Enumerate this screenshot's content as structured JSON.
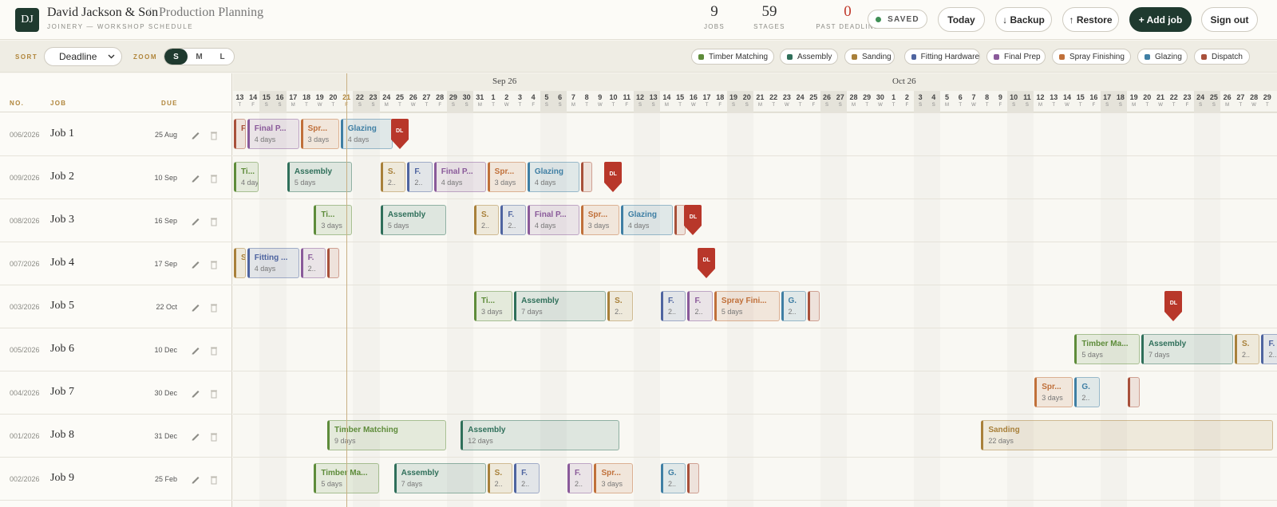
{
  "header": {
    "logo": "DJ",
    "company": "David Jackson & Son",
    "separator": "/",
    "page": "Production Planning",
    "subtitle": "JOINERY — WORKSHOP SCHEDULE",
    "stats": [
      {
        "value": "9",
        "label": "JOBS"
      },
      {
        "value": "59",
        "label": "STAGES"
      },
      {
        "value": "0",
        "label": "PAST DEADLINE"
      }
    ],
    "saved": "SAVED",
    "buttons": {
      "today": "Today",
      "backup": "↓ Backup",
      "restore": "↑ Restore",
      "add_job": "+ Add job",
      "sign_out": "Sign out"
    }
  },
  "toolbar": {
    "sort_label": "SORT",
    "sort_value": "Deadline",
    "zoom_label": "ZOOM",
    "zoom": [
      "S",
      "M",
      "L"
    ],
    "zoom_active": "S"
  },
  "stages": [
    {
      "name": "Timber Matching",
      "color": "#5e8c3a"
    },
    {
      "name": "Assembly",
      "color": "#2f6f5a"
    },
    {
      "name": "Sanding",
      "color": "#a8803a"
    },
    {
      "name": "Fitting Hardware",
      "color": "#4e64a0"
    },
    {
      "name": "Final Prep",
      "color": "#8a5a9a"
    },
    {
      "name": "Spray Finishing",
      "color": "#c0703a"
    },
    {
      "name": "Glazing",
      "color": "#3f7fa4"
    },
    {
      "name": "Dispatch",
      "color": "#a8503a"
    }
  ],
  "columns": {
    "no": "NO.",
    "job": "JOB",
    "due": "DUE"
  },
  "jobs": [
    {
      "no": "006/2026",
      "name": "Job 1",
      "due": "25 Aug"
    },
    {
      "no": "009/2026",
      "name": "Job 2",
      "due": "10 Sep"
    },
    {
      "no": "008/2026",
      "name": "Job 3",
      "due": "16 Sep"
    },
    {
      "no": "007/2026",
      "name": "Job 4",
      "due": "17 Sep"
    },
    {
      "no": "003/2026",
      "name": "Job 5",
      "due": "22 Oct"
    },
    {
      "no": "005/2026",
      "name": "Job 6",
      "due": "10 Dec"
    },
    {
      "no": "004/2026",
      "name": "Job 7",
      "due": "30 Dec"
    },
    {
      "no": "001/2026",
      "name": "Job 8",
      "due": "31 Dec"
    },
    {
      "no": "002/2026",
      "name": "Job 9",
      "due": "25 Feb"
    }
  ],
  "timeline": {
    "months": [
      "Sep 26",
      "Oct 26"
    ],
    "start_date": "2026-08-13",
    "days_visible": 78,
    "today": "2026-08-21",
    "deadline_marker": "DL",
    "bars": [
      {
        "row": 0,
        "stage": 7,
        "start": "2026-08-13",
        "days": 1,
        "title": "F.",
        "sub": ""
      },
      {
        "row": 0,
        "stage": 4,
        "start": "2026-08-14",
        "days": 4,
        "title": "Final P...",
        "sub": "4 days"
      },
      {
        "row": 0,
        "stage": 5,
        "start": "2026-08-18",
        "days": 3,
        "title": "Spr...",
        "sub": "3 days"
      },
      {
        "row": 0,
        "stage": 6,
        "start": "2026-08-21",
        "days": 4,
        "title": "Glazing",
        "sub": "4 days"
      },
      {
        "row": 1,
        "stage": 0,
        "start": "2026-08-13",
        "days": 2,
        "title": "Ti...",
        "sub": "4 days"
      },
      {
        "row": 1,
        "stage": 1,
        "start": "2026-08-17",
        "days": 5,
        "title": "Assembly",
        "sub": "5 days"
      },
      {
        "row": 1,
        "stage": 2,
        "start": "2026-08-24",
        "days": 2,
        "title": "S.",
        "sub": "2.."
      },
      {
        "row": 1,
        "stage": 3,
        "start": "2026-08-26",
        "days": 2,
        "title": "F.",
        "sub": "2.."
      },
      {
        "row": 1,
        "stage": 4,
        "start": "2026-08-28",
        "days": 4,
        "title": "Final P...",
        "sub": "4 days"
      },
      {
        "row": 1,
        "stage": 5,
        "start": "2026-09-01",
        "days": 3,
        "title": "Spr...",
        "sub": "3 days"
      },
      {
        "row": 1,
        "stage": 6,
        "start": "2026-09-04",
        "days": 4,
        "title": "Glazing",
        "sub": "4 days"
      },
      {
        "row": 1,
        "stage": 7,
        "start": "2026-09-08",
        "days": 1,
        "title": "",
        "sub": ""
      },
      {
        "row": 2,
        "stage": 0,
        "start": "2026-08-19",
        "days": 3,
        "title": "Ti...",
        "sub": "3 days"
      },
      {
        "row": 2,
        "stage": 1,
        "start": "2026-08-24",
        "days": 5,
        "title": "Assembly",
        "sub": "5 days"
      },
      {
        "row": 2,
        "stage": 2,
        "start": "2026-08-31",
        "days": 2,
        "title": "S.",
        "sub": "2.."
      },
      {
        "row": 2,
        "stage": 3,
        "start": "2026-09-02",
        "days": 2,
        "title": "F.",
        "sub": "2.."
      },
      {
        "row": 2,
        "stage": 4,
        "start": "2026-09-04",
        "days": 4,
        "title": "Final P...",
        "sub": "4 days"
      },
      {
        "row": 2,
        "stage": 5,
        "start": "2026-09-08",
        "days": 3,
        "title": "Spr...",
        "sub": "3 days"
      },
      {
        "row": 2,
        "stage": 6,
        "start": "2026-09-11",
        "days": 4,
        "title": "Glazing",
        "sub": "4 days"
      },
      {
        "row": 2,
        "stage": 7,
        "start": "2026-09-15",
        "days": 1,
        "title": "",
        "sub": ""
      },
      {
        "row": 3,
        "stage": 2,
        "start": "2026-08-13",
        "days": 1,
        "title": "S.",
        "sub": ""
      },
      {
        "row": 3,
        "stage": 3,
        "start": "2026-08-14",
        "days": 4,
        "title": "Fitting ...",
        "sub": "4 days"
      },
      {
        "row": 3,
        "stage": 4,
        "start": "2026-08-18",
        "days": 2,
        "title": "F.",
        "sub": "2.."
      },
      {
        "row": 3,
        "stage": 7,
        "start": "2026-08-20",
        "days": 1,
        "title": "",
        "sub": ""
      },
      {
        "row": 4,
        "stage": 0,
        "start": "2026-08-31",
        "days": 3,
        "title": "Ti...",
        "sub": "3 days"
      },
      {
        "row": 4,
        "stage": 1,
        "start": "2026-09-03",
        "days": 7,
        "title": "Assembly",
        "sub": "7 days"
      },
      {
        "row": 4,
        "stage": 2,
        "start": "2026-09-10",
        "days": 2,
        "title": "S.",
        "sub": "2.."
      },
      {
        "row": 4,
        "stage": 3,
        "start": "2026-09-14",
        "days": 2,
        "title": "F.",
        "sub": "2.."
      },
      {
        "row": 4,
        "stage": 4,
        "start": "2026-09-16",
        "days": 2,
        "title": "F.",
        "sub": "2.."
      },
      {
        "row": 4,
        "stage": 5,
        "start": "2026-09-18",
        "days": 5,
        "title": "Spray Fini...",
        "sub": "5 days"
      },
      {
        "row": 4,
        "stage": 6,
        "start": "2026-09-23",
        "days": 2,
        "title": "G.",
        "sub": "2.."
      },
      {
        "row": 4,
        "stage": 7,
        "start": "2026-09-25",
        "days": 1,
        "title": "",
        "sub": ""
      },
      {
        "row": 5,
        "stage": 0,
        "start": "2026-10-15",
        "days": 5,
        "title": "Timber Ma...",
        "sub": "5 days"
      },
      {
        "row": 5,
        "stage": 1,
        "start": "2026-10-20",
        "days": 7,
        "title": "Assembly",
        "sub": "7 days"
      },
      {
        "row": 5,
        "stage": 2,
        "start": "2026-10-27",
        "days": 2,
        "title": "S.",
        "sub": "2.."
      },
      {
        "row": 5,
        "stage": 3,
        "start": "2026-10-29",
        "days": 2,
        "title": "F.",
        "sub": "2.."
      },
      {
        "row": 6,
        "stage": 5,
        "start": "2026-10-12",
        "days": 3,
        "title": "Spr...",
        "sub": "3 days"
      },
      {
        "row": 6,
        "stage": 6,
        "start": "2026-10-15",
        "days": 2,
        "title": "G.",
        "sub": "2.."
      },
      {
        "row": 6,
        "stage": 7,
        "start": "2026-10-19",
        "days": 1,
        "title": "",
        "sub": ""
      },
      {
        "row": 7,
        "stage": 0,
        "start": "2026-08-20",
        "days": 9,
        "title": "Timber Matching",
        "sub": "9 days"
      },
      {
        "row": 7,
        "stage": 1,
        "start": "2026-08-30",
        "days": 12,
        "title": "Assembly",
        "sub": "12 days"
      },
      {
        "row": 7,
        "stage": 2,
        "start": "2026-10-08",
        "days": 22,
        "title": "Sanding",
        "sub": "22 days"
      },
      {
        "row": 8,
        "stage": 0,
        "start": "2026-08-19",
        "days": 5,
        "title": "Timber Ma...",
        "sub": "5 days"
      },
      {
        "row": 8,
        "stage": 1,
        "start": "2026-08-25",
        "days": 7,
        "title": "Assembly",
        "sub": "7 days"
      },
      {
        "row": 8,
        "stage": 2,
        "start": "2026-09-01",
        "days": 2,
        "title": "S.",
        "sub": "2.."
      },
      {
        "row": 8,
        "stage": 3,
        "start": "2026-09-03",
        "days": 2,
        "title": "F.",
        "sub": "2.."
      },
      {
        "row": 8,
        "stage": 4,
        "start": "2026-09-07",
        "days": 2,
        "title": "F.",
        "sub": "2.."
      },
      {
        "row": 8,
        "stage": 5,
        "start": "2026-09-09",
        "days": 3,
        "title": "Spr...",
        "sub": "3 days"
      },
      {
        "row": 8,
        "stage": 6,
        "start": "2026-09-14",
        "days": 2,
        "title": "G.",
        "sub": "2.."
      },
      {
        "row": 8,
        "stage": 7,
        "start": "2026-09-16",
        "days": 1,
        "title": "",
        "sub": ""
      }
    ],
    "deadlines": [
      {
        "row": 0,
        "date": "2026-08-25"
      },
      {
        "row": 1,
        "date": "2026-09-10"
      },
      {
        "row": 2,
        "date": "2026-09-16"
      },
      {
        "row": 3,
        "date": "2026-09-17"
      },
      {
        "row": 4,
        "date": "2026-10-22"
      }
    ]
  }
}
